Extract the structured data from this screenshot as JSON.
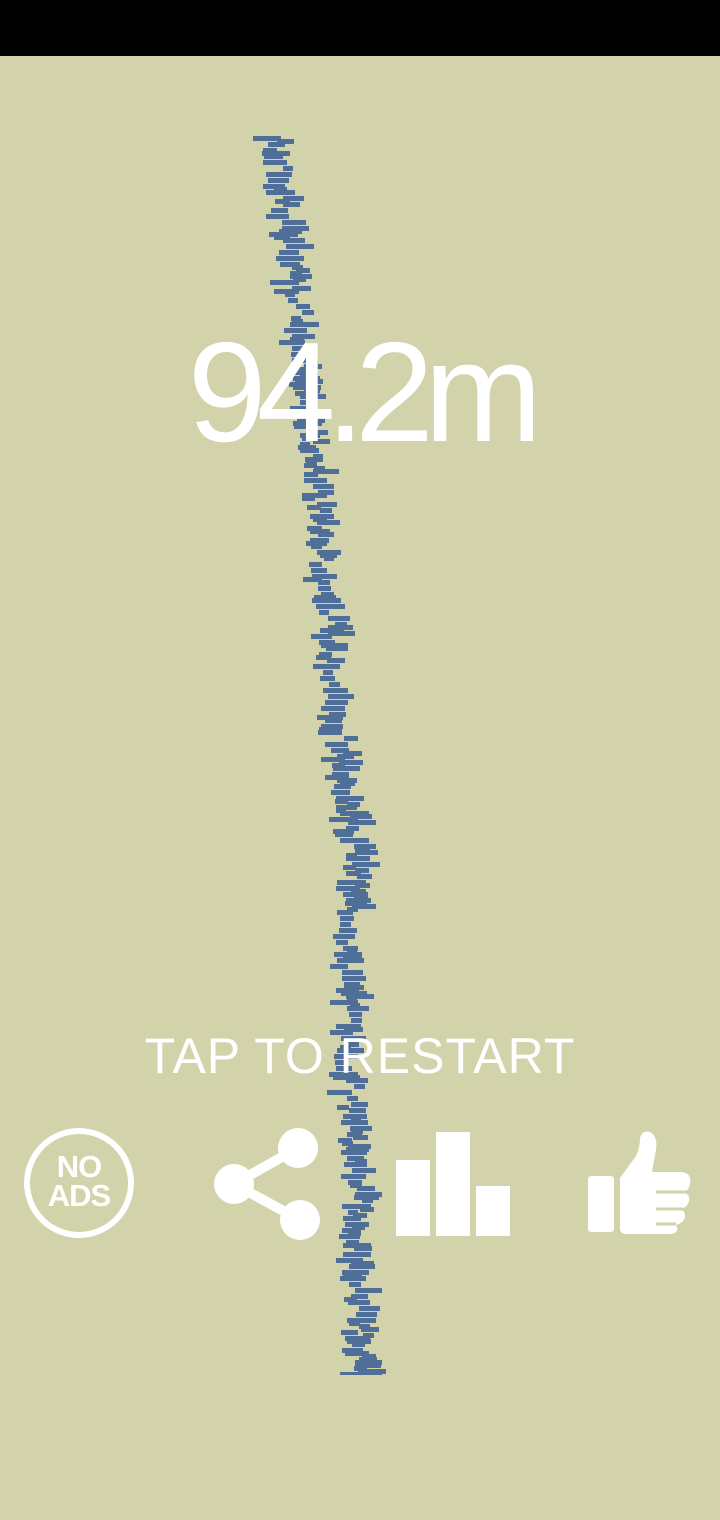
{
  "status_bar": {
    "color": "#000000"
  },
  "game": {
    "background_color": "#d2d3aa",
    "tower_color": "#4f6f98",
    "height_text": "94.2m",
    "restart_text": "TAP TO RESTART"
  },
  "buttons": {
    "no_ads": {
      "label_line1": "NO",
      "label_line2": "ADS",
      "icon": "no-ads-badge-icon"
    },
    "share": {
      "icon": "share-icon"
    },
    "leaderboard": {
      "icon": "bar-chart-icon"
    },
    "like": {
      "icon": "thumbs-up-icon"
    }
  }
}
